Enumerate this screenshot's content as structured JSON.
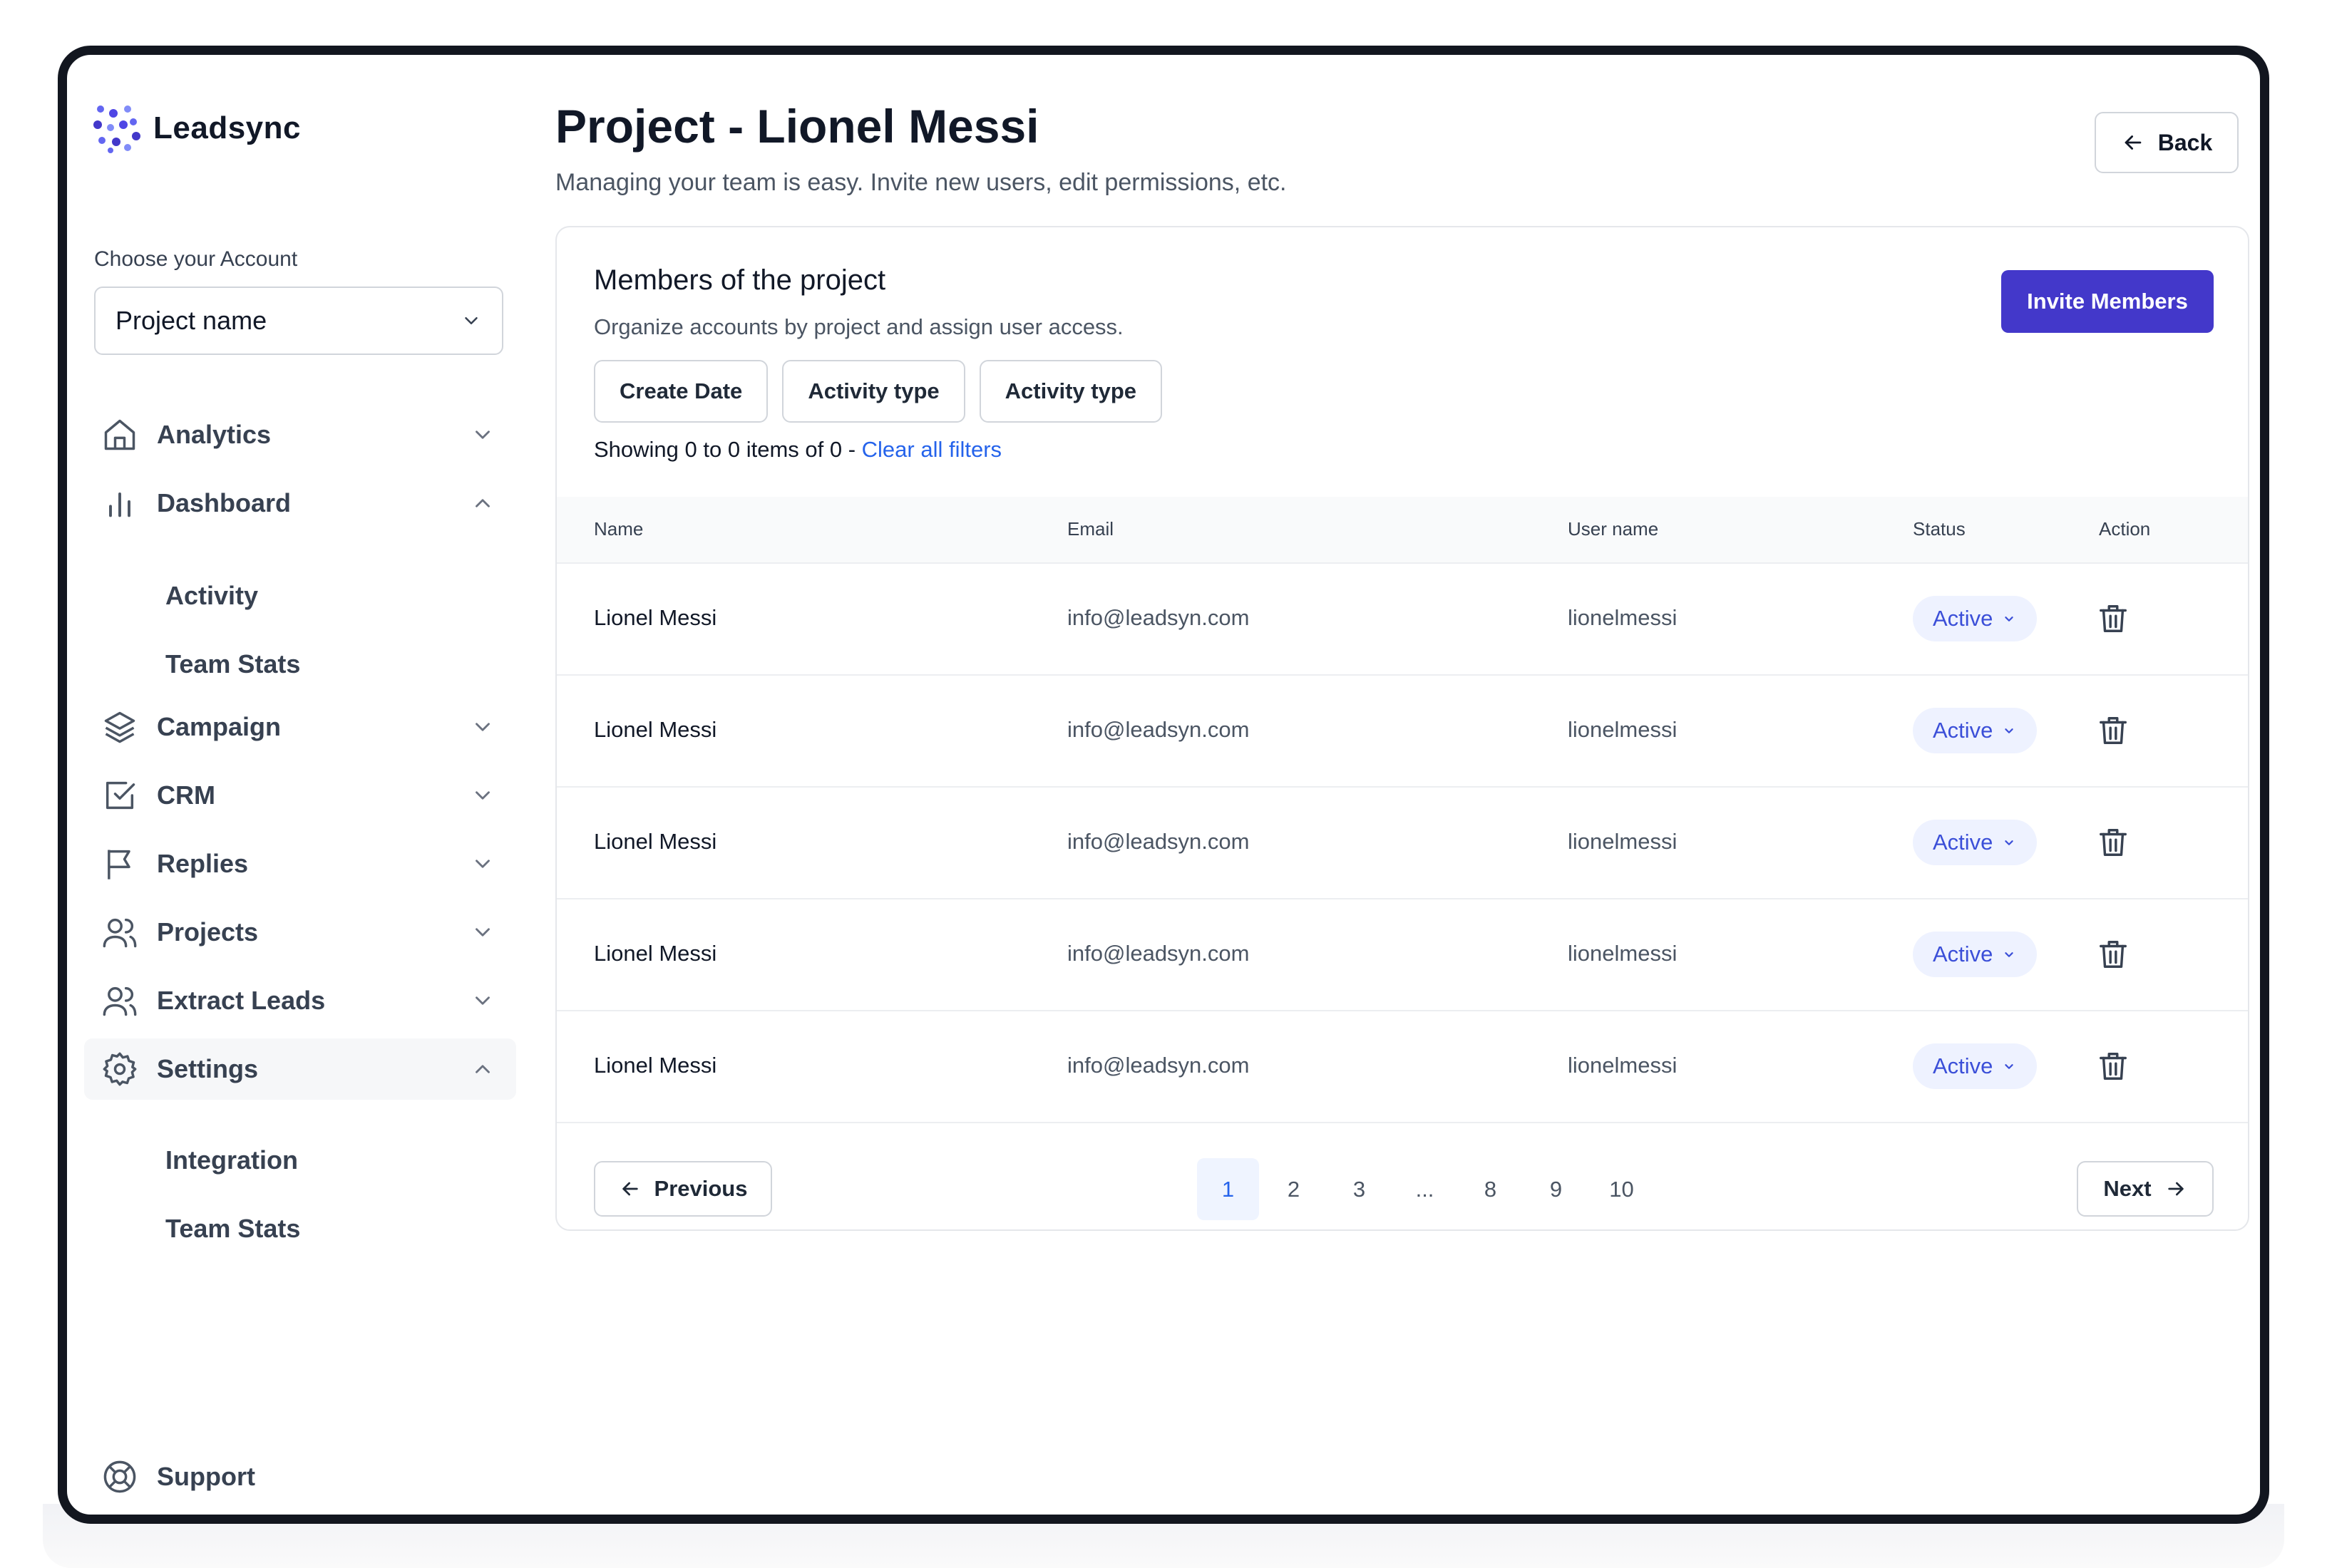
{
  "brand": {
    "name": "Leadsync",
    "accent": "#6366f1"
  },
  "account": {
    "label": "Choose your Account",
    "selected": "Project name"
  },
  "nav": {
    "analytics": "Analytics",
    "dashboard": "Dashboard",
    "dashboard_sub": [
      "Activity",
      "Team Stats"
    ],
    "campaign": "Campaign",
    "crm": "CRM",
    "replies": "Replies",
    "projects": "Projects",
    "extract_leads": "Extract Leads",
    "settings": "Settings",
    "settings_sub": [
      "Integration",
      "Team Stats"
    ],
    "support": "Support"
  },
  "header": {
    "title": "Project - Lionel Messi",
    "subtitle": "Managing your team is easy. Invite new users, edit permissions, etc.",
    "back_label": "Back"
  },
  "card": {
    "title": "Members of the project",
    "subtitle": "Organize accounts by project and assign user access.",
    "invite_label": "Invite Members",
    "invite_color": "#4338ca",
    "filters": [
      "Create Date",
      "Activity type",
      "Activity type"
    ],
    "showing_text": "Showing 0 to 0 items of 0 -",
    "clear_filters": "Clear all filters"
  },
  "table": {
    "columns": [
      "Name",
      "Email",
      "User name",
      "Status",
      "Action"
    ],
    "rows": [
      {
        "name": "Lionel Messi",
        "email": "info@leadsyn.com",
        "username": "lionelmessi",
        "status": "Active"
      },
      {
        "name": "Lionel Messi",
        "email": "info@leadsyn.com",
        "username": "lionelmessi",
        "status": "Active"
      },
      {
        "name": "Lionel Messi",
        "email": "info@leadsyn.com",
        "username": "lionelmessi",
        "status": "Active"
      },
      {
        "name": "Lionel Messi",
        "email": "info@leadsyn.com",
        "username": "lionelmessi",
        "status": "Active"
      },
      {
        "name": "Lionel Messi",
        "email": "info@leadsyn.com",
        "username": "lionelmessi",
        "status": "Active"
      }
    ]
  },
  "pagination": {
    "previous": "Previous",
    "next": "Next",
    "pages": [
      "1",
      "2",
      "3",
      "...",
      "8",
      "9",
      "10"
    ],
    "current": "1"
  }
}
